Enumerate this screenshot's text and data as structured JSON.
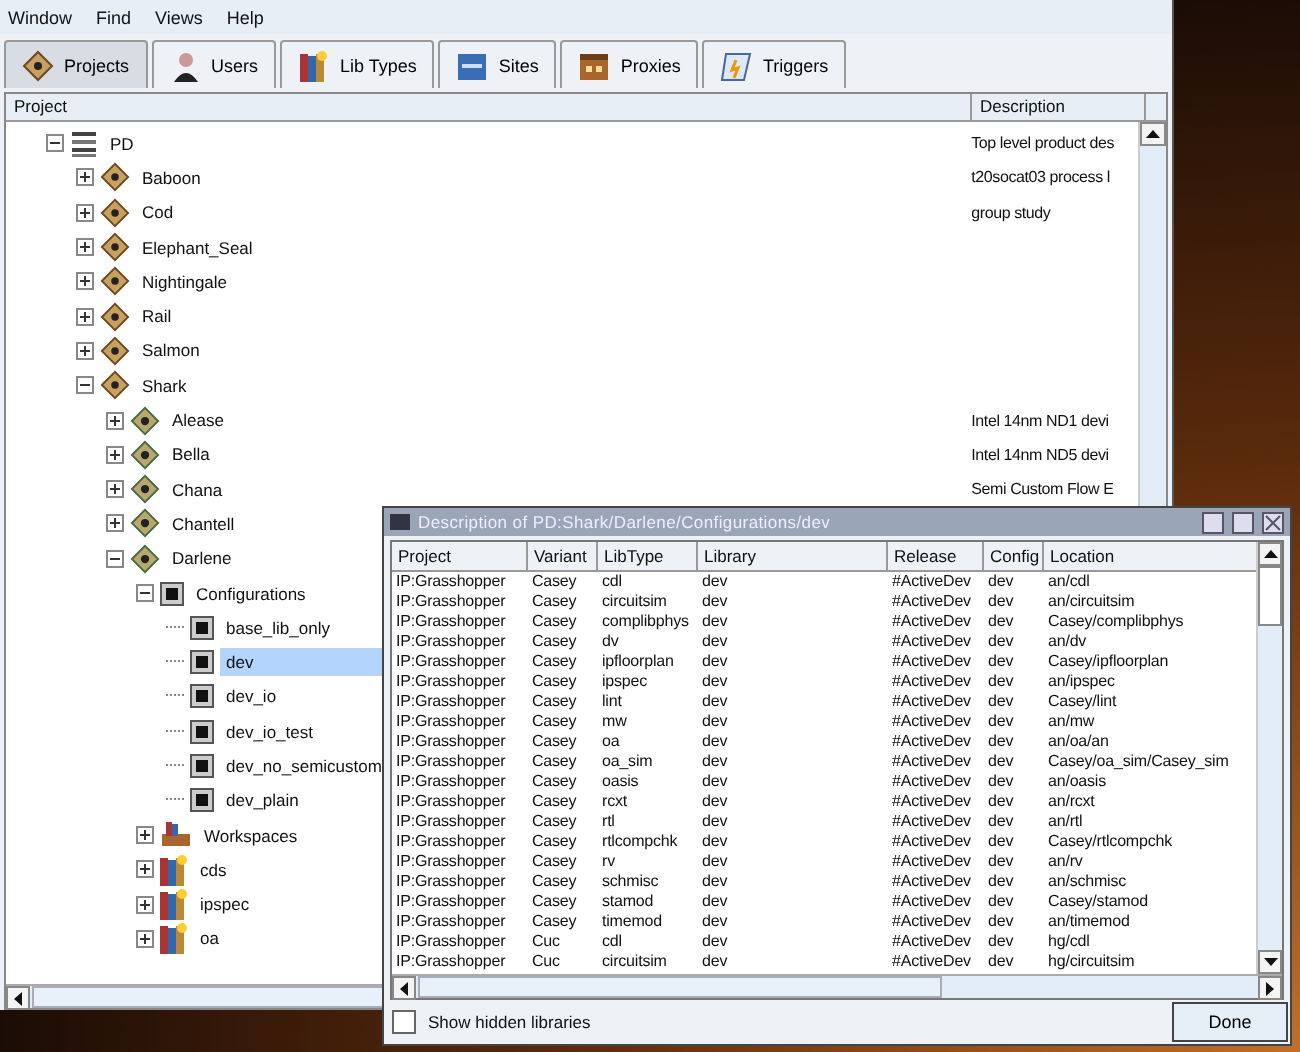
{
  "menu": [
    "Window",
    "Find",
    "Views",
    "Help"
  ],
  "tabs": [
    {
      "label": "Projects",
      "selected": true
    },
    {
      "label": "Users",
      "selected": false
    },
    {
      "label": "Lib Types",
      "selected": false
    },
    {
      "label": "Sites",
      "selected": false
    },
    {
      "label": "Proxies",
      "selected": false
    },
    {
      "label": "Triggers",
      "selected": false
    }
  ],
  "tree": {
    "columns": [
      "Project",
      "Description"
    ],
    "nodes": [
      {
        "label": "PD",
        "kind": "product",
        "expanded": true,
        "description": "Top level product des",
        "children": [
          {
            "label": "Baboon",
            "kind": "project",
            "expanded": false,
            "description": "t20socat03 process l"
          },
          {
            "label": "Cod",
            "kind": "project",
            "expanded": false,
            "description": "group study"
          },
          {
            "label": "Elephant_Seal",
            "kind": "project",
            "expanded": false
          },
          {
            "label": "Nightingale",
            "kind": "project",
            "expanded": false
          },
          {
            "label": "Rail",
            "kind": "project",
            "expanded": false
          },
          {
            "label": "Salmon",
            "kind": "project",
            "expanded": false
          },
          {
            "label": "Shark",
            "kind": "project",
            "expanded": true,
            "children": [
              {
                "label": "Alease",
                "kind": "variant",
                "expanded": false,
                "description": "Intel 14nm ND1 devi"
              },
              {
                "label": "Bella",
                "kind": "variant",
                "expanded": false,
                "description": "Intel 14nm ND5 devi"
              },
              {
                "label": "Chana",
                "kind": "variant",
                "expanded": false,
                "description": "Semi Custom Flow E"
              },
              {
                "label": "Chantell",
                "kind": "variant",
                "expanded": false
              },
              {
                "label": "Darlene",
                "kind": "variant",
                "expanded": true,
                "children": [
                  {
                    "label": "Configurations",
                    "kind": "configs",
                    "expanded": true,
                    "children": [
                      {
                        "label": "base_lib_only",
                        "kind": "config",
                        "selected": false
                      },
                      {
                        "label": "dev",
                        "kind": "config",
                        "selected": true
                      },
                      {
                        "label": "dev_io",
                        "kind": "config",
                        "selected": false
                      },
                      {
                        "label": "dev_io_test",
                        "kind": "config",
                        "selected": false
                      },
                      {
                        "label": "dev_no_semicustom",
                        "kind": "config",
                        "selected": false
                      },
                      {
                        "label": "dev_plain",
                        "kind": "config",
                        "selected": false
                      }
                    ]
                  },
                  {
                    "label": "Workspaces",
                    "kind": "workspaces",
                    "expanded": false
                  },
                  {
                    "label": "cds",
                    "kind": "libtype",
                    "expanded": false
                  },
                  {
                    "label": "ipspec",
                    "kind": "libtype",
                    "expanded": false
                  },
                  {
                    "label": "oa",
                    "kind": "libtype",
                    "expanded": false
                  }
                ]
              }
            ]
          }
        ]
      }
    ]
  },
  "dialog": {
    "title": "Description of PD:Shark/Darlene/Configurations/dev",
    "columns": [
      "Project",
      "Variant",
      "LibType",
      "Library",
      "Release",
      "Config",
      "Location"
    ],
    "rows": [
      [
        "IP:Grasshopper",
        "Casey",
        "cdl",
        "dev",
        "#ActiveDev",
        "dev",
        "an/cdl"
      ],
      [
        "IP:Grasshopper",
        "Casey",
        "circuitsim",
        "dev",
        "#ActiveDev",
        "dev",
        "an/circuitsim"
      ],
      [
        "IP:Grasshopper",
        "Casey",
        "complibphys",
        "dev",
        "#ActiveDev",
        "dev",
        "Casey/complibphys"
      ],
      [
        "IP:Grasshopper",
        "Casey",
        "dv",
        "dev",
        "#ActiveDev",
        "dev",
        "an/dv"
      ],
      [
        "IP:Grasshopper",
        "Casey",
        "ipfloorplan",
        "dev",
        "#ActiveDev",
        "dev",
        "Casey/ipfloorplan"
      ],
      [
        "IP:Grasshopper",
        "Casey",
        "ipspec",
        "dev",
        "#ActiveDev",
        "dev",
        "an/ipspec"
      ],
      [
        "IP:Grasshopper",
        "Casey",
        "lint",
        "dev",
        "#ActiveDev",
        "dev",
        "Casey/lint"
      ],
      [
        "IP:Grasshopper",
        "Casey",
        "mw",
        "dev",
        "#ActiveDev",
        "dev",
        "an/mw"
      ],
      [
        "IP:Grasshopper",
        "Casey",
        "oa",
        "dev",
        "#ActiveDev",
        "dev",
        "an/oa/an"
      ],
      [
        "IP:Grasshopper",
        "Casey",
        "oa_sim",
        "dev",
        "#ActiveDev",
        "dev",
        "Casey/oa_sim/Casey_sim"
      ],
      [
        "IP:Grasshopper",
        "Casey",
        "oasis",
        "dev",
        "#ActiveDev",
        "dev",
        "an/oasis"
      ],
      [
        "IP:Grasshopper",
        "Casey",
        "rcxt",
        "dev",
        "#ActiveDev",
        "dev",
        "an/rcxt"
      ],
      [
        "IP:Grasshopper",
        "Casey",
        "rtl",
        "dev",
        "#ActiveDev",
        "dev",
        "an/rtl"
      ],
      [
        "IP:Grasshopper",
        "Casey",
        "rtlcompchk",
        "dev",
        "#ActiveDev",
        "dev",
        "Casey/rtlcompchk"
      ],
      [
        "IP:Grasshopper",
        "Casey",
        "rv",
        "dev",
        "#ActiveDev",
        "dev",
        "an/rv"
      ],
      [
        "IP:Grasshopper",
        "Casey",
        "schmisc",
        "dev",
        "#ActiveDev",
        "dev",
        "an/schmisc"
      ],
      [
        "IP:Grasshopper",
        "Casey",
        "stamod",
        "dev",
        "#ActiveDev",
        "dev",
        "Casey/stamod"
      ],
      [
        "IP:Grasshopper",
        "Casey",
        "timemod",
        "dev",
        "#ActiveDev",
        "dev",
        "an/timemod"
      ],
      [
        "IP:Grasshopper",
        "Cuc",
        "cdl",
        "dev",
        "#ActiveDev",
        "dev",
        "hg/cdl"
      ],
      [
        "IP:Grasshopper",
        "Cuc",
        "circuitsim",
        "dev",
        "#ActiveDev",
        "dev",
        "hg/circuitsim"
      ]
    ],
    "show_hidden": {
      "label": "Show hidden libraries",
      "checked": false
    },
    "done": "Done"
  }
}
